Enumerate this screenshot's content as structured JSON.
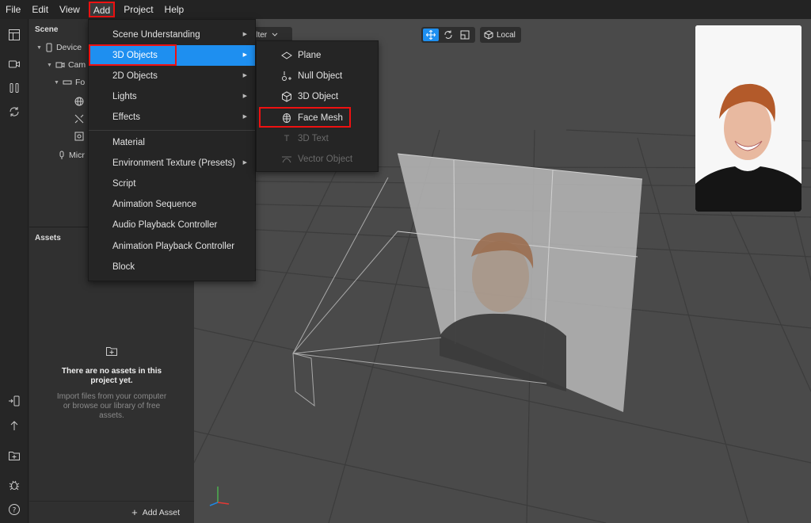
{
  "menubar": {
    "items": [
      "File",
      "Edit",
      "View",
      "Add",
      "Project",
      "Help"
    ]
  },
  "scene": {
    "title": "Scene",
    "tree": [
      "Device",
      "Cam",
      "Fo",
      "Micr"
    ]
  },
  "assets": {
    "title": "Assets",
    "empty_title_1": "There are no assets in this",
    "empty_title_2": "project yet.",
    "empty_sub_1": "Import files from your computer",
    "empty_sub_2": "or browse our library of free",
    "empty_sub_3": "assets.",
    "add_label": "Add Asset",
    "add_icon": "+"
  },
  "viewport": {
    "filter_label": "ilter",
    "local_label": "Local"
  },
  "add_menu": {
    "items": [
      "Scene Understanding",
      "3D Objects",
      "2D Objects",
      "Lights",
      "Effects",
      "Material",
      "Environment Texture (Presets)",
      "Script",
      "Animation Sequence",
      "Audio Playback Controller",
      "Animation Playback Controller",
      "Block"
    ]
  },
  "submenu_3d": {
    "items": [
      "Plane",
      "Null Object",
      "3D Object",
      "Face Mesh",
      "3D Text",
      "Vector Object"
    ]
  },
  "colors": {
    "accent": "#1e8ff0",
    "highlight_box": "#ee1111"
  }
}
